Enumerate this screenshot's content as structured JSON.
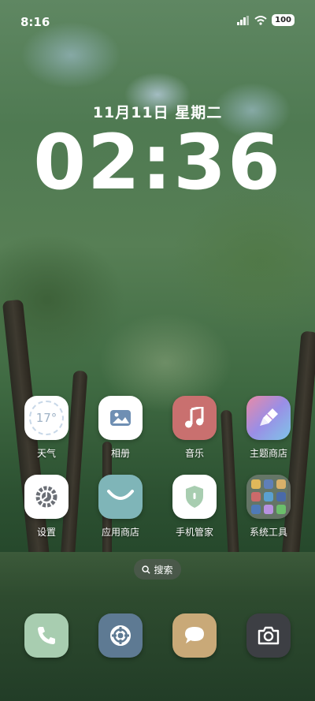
{
  "status_bar": {
    "time": "8:16",
    "battery": "100"
  },
  "lockscreen": {
    "date": "11月11日 星期二",
    "clock": "02:36"
  },
  "weather_widget": {
    "temp": "17°"
  },
  "apps": [
    {
      "label": "天气",
      "icon": "weather-icon"
    },
    {
      "label": "相册",
      "icon": "gallery-icon"
    },
    {
      "label": "音乐",
      "icon": "music-icon"
    },
    {
      "label": "主题商店",
      "icon": "theme-store-icon"
    },
    {
      "label": "设置",
      "icon": "settings-icon"
    },
    {
      "label": "应用商店",
      "icon": "app-store-icon"
    },
    {
      "label": "手机管家",
      "icon": "phone-manager-icon"
    },
    {
      "label": "系统工具",
      "icon": "system-tools-folder-icon"
    }
  ],
  "search": {
    "label": "搜索"
  },
  "dock": [
    {
      "icon": "phone-icon"
    },
    {
      "icon": "browser-icon"
    },
    {
      "icon": "messages-icon"
    },
    {
      "icon": "camera-icon"
    }
  ],
  "colors": {
    "music": "#c9706f",
    "app_store": "#7fb5b8",
    "phone": "#a8cdb0",
    "browser": "#5e7a93",
    "messages": "#c9a978",
    "camera": "#3d3f44"
  }
}
